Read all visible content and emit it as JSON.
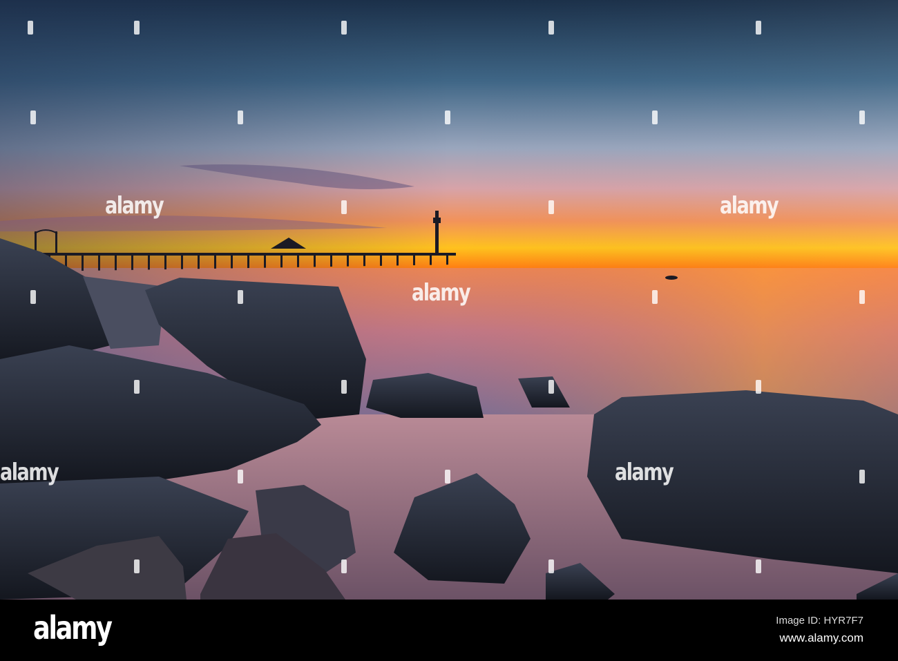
{
  "watermark": {
    "brand": "alamy"
  },
  "footer": {
    "logo": "alamy",
    "image_id": "Image ID: HYR7F7",
    "website": "www.alamy.com"
  }
}
